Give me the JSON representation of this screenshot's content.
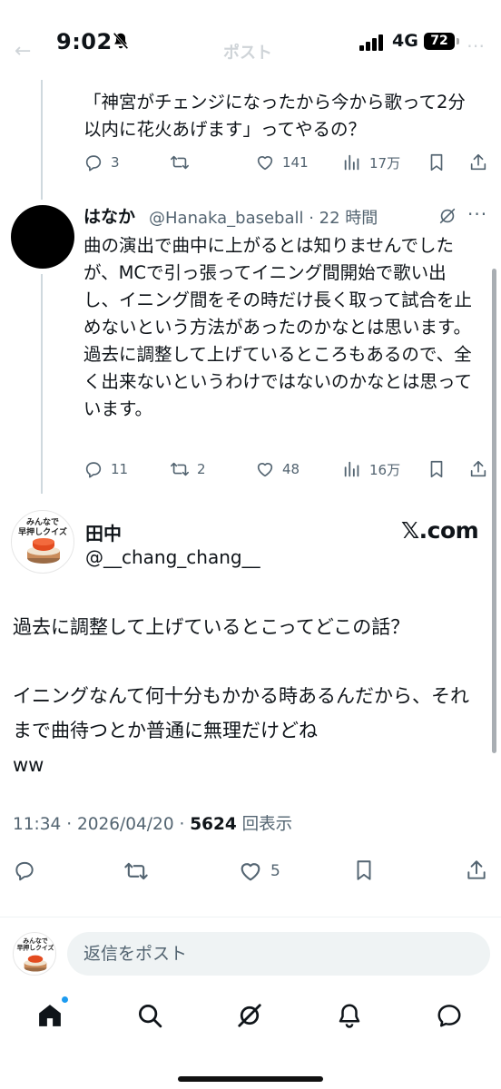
{
  "status_bar": {
    "time": "9:02",
    "network": "4G",
    "battery": "72",
    "title": "ポスト"
  },
  "tweet1": {
    "text": "「神宮がチェンジになったから今から歌って2分以内に花火あげます」ってやるの？",
    "replies": "3",
    "likes": "141",
    "views": "17万"
  },
  "tweet2": {
    "name": "はなか",
    "handle": "@Hanaka_baseball · 22 時間",
    "text": "曲の演出で曲中に上がるとは知りませんでしたが、MCで引っ張ってイニング間開始で歌い出し、イニング間をその時だけ長く取って試合を止めないという方法があったのかなとは思います。\n過去に調整して上げているところもあるので、全く出来ないというわけではないのかなとは思っています。",
    "replies": "11",
    "reposts": "2",
    "likes": "48",
    "views": "16万"
  },
  "quote": {
    "avatar_text": "みんなで\n早押しクイズ",
    "name": "田中",
    "handle": "@__chang_chang__",
    "source": "𝕏.com",
    "text": "過去に調整して上げているとこってどこの話？\n\nイニングなんて何十分もかかる時あるんだから、それまで曲待つとか普通に無理だけどね\nww",
    "time": "11:34 · 2026/04/20 · ",
    "views_count": "5624",
    "views_label": " 回表示",
    "likes": "5"
  },
  "reply_bar": {
    "placeholder": "返信をポスト"
  },
  "colors": {
    "accent": "#1d9bf0",
    "muted": "#536471",
    "text": "#0f1419",
    "border": "#cfd9de"
  }
}
